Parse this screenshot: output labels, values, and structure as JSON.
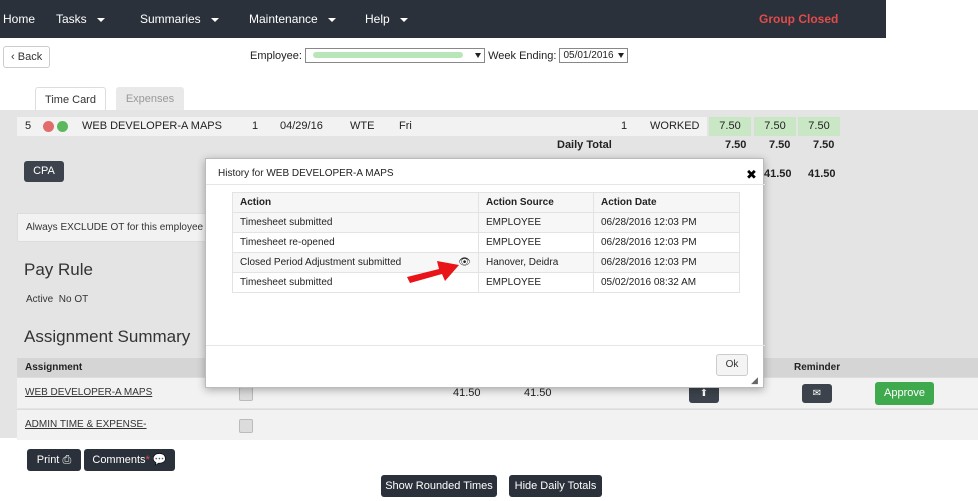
{
  "nav": {
    "items": [
      {
        "label": "Home",
        "caret": false
      },
      {
        "label": "Tasks",
        "caret": true
      },
      {
        "label": "Summaries",
        "caret": true
      },
      {
        "label": "Maintenance",
        "caret": true
      },
      {
        "label": "Help",
        "caret": true
      }
    ],
    "status": "Group Closed"
  },
  "back_label": "Back",
  "employee_label": "Employee:",
  "employee_value": "",
  "week_label": "Week Ending:",
  "week_value": "05/01/2016",
  "tabs": [
    "Time Card",
    "Expenses"
  ],
  "time_row": {
    "num": "5",
    "name": "WEB DEVELOPER-A MAPS",
    "qty": "1",
    "date": "04/29/16",
    "code": "WTE",
    "day": "Fri",
    "count": "1",
    "type": "WORKED",
    "hours": [
      "7.50",
      "7.50",
      "7.50"
    ]
  },
  "daily_total": {
    "label": "Daily Total",
    "values": [
      "7.50",
      "7.50",
      "7.50"
    ]
  },
  "totals": {
    "a": "41.50",
    "b": "41.50"
  },
  "cpa_label": "CPA",
  "exclude_text": "Always EXCLUDE OT for this employee",
  "pay_rule": {
    "title": "Pay Rule",
    "active": "Active",
    "rule": "No OT"
  },
  "assignment": {
    "title": "Assignment Summary",
    "header_assignment": "Assignment",
    "header_reminder": "Reminder",
    "rows": [
      {
        "name": "WEB DEVELOPER-A MAPS",
        "v1": "41.50",
        "v2": "41.50"
      },
      {
        "name": "ADMIN TIME & EXPENSE-"
      }
    ],
    "approve_label": "Approve"
  },
  "bottom": {
    "print": "Print",
    "comments": "Comments",
    "show_rounded": "Show Rounded Times",
    "hide_daily": "Hide Daily Totals"
  },
  "modal": {
    "title": "History for WEB DEVELOPER-A MAPS",
    "headers": [
      "Action",
      "Action Source",
      "Action Date"
    ],
    "rows": [
      {
        "action": "Timesheet submitted",
        "source": "EMPLOYEE",
        "date": "06/28/2016 12:03 PM",
        "eye": false
      },
      {
        "action": "Timesheet re-opened",
        "source": "EMPLOYEE",
        "date": "06/28/2016 12:03 PM",
        "eye": false
      },
      {
        "action": "Closed Period Adjustment submitted",
        "source": "Hanover, Deidra",
        "date": "06/28/2016 12:03 PM",
        "eye": true
      },
      {
        "action": "Timesheet submitted",
        "source": "EMPLOYEE",
        "date": "05/02/2016 08:32 AM",
        "eye": false
      }
    ],
    "ok_label": "Ok"
  },
  "colors": {
    "nav_bg": "#2b313a",
    "status_red": "#e24b4b",
    "approve_green": "#3fa94e",
    "hour_cell_green": "#c9e7c4",
    "arrow_red": "#e8141a"
  }
}
